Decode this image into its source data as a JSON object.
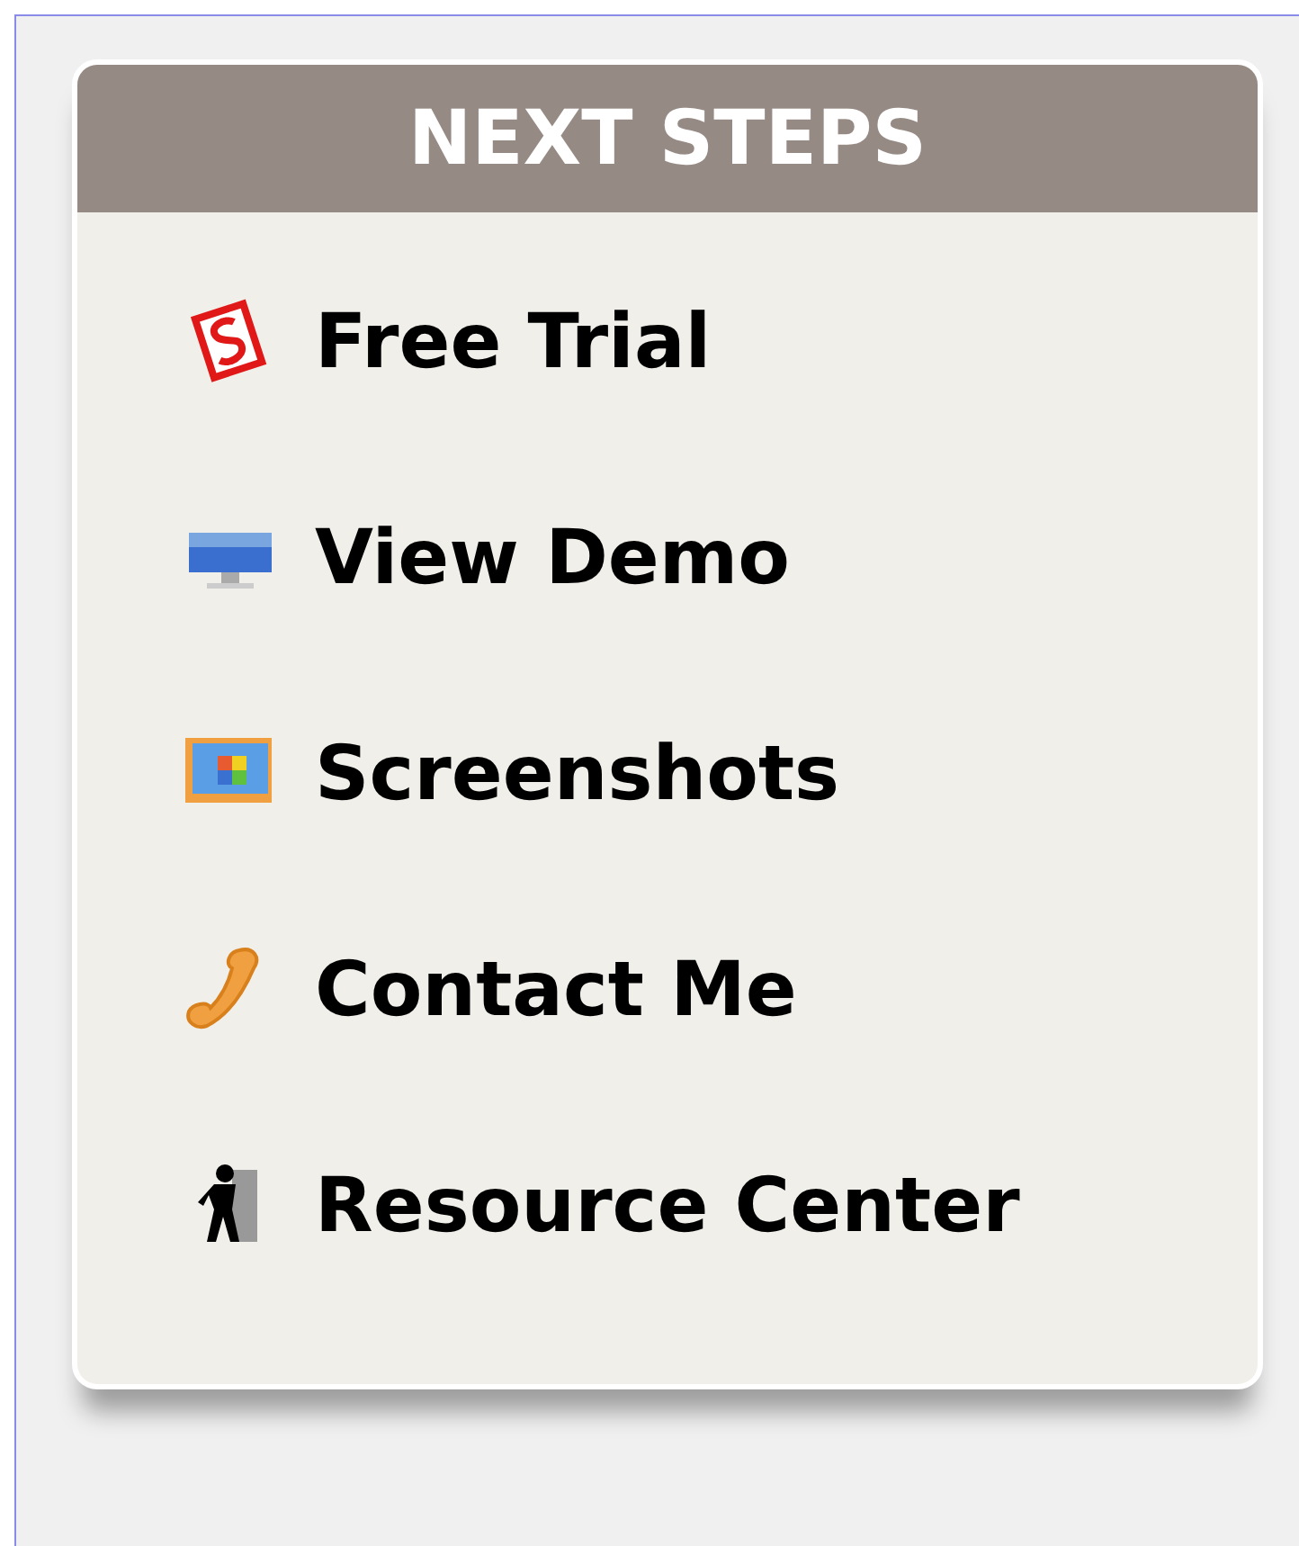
{
  "panel": {
    "title": "NEXT STEPS",
    "items": [
      {
        "label": "Free Trial"
      },
      {
        "label": "View Demo"
      },
      {
        "label": "Screenshots"
      },
      {
        "label": "Contact Me"
      },
      {
        "label": "Resource Center"
      }
    ]
  }
}
